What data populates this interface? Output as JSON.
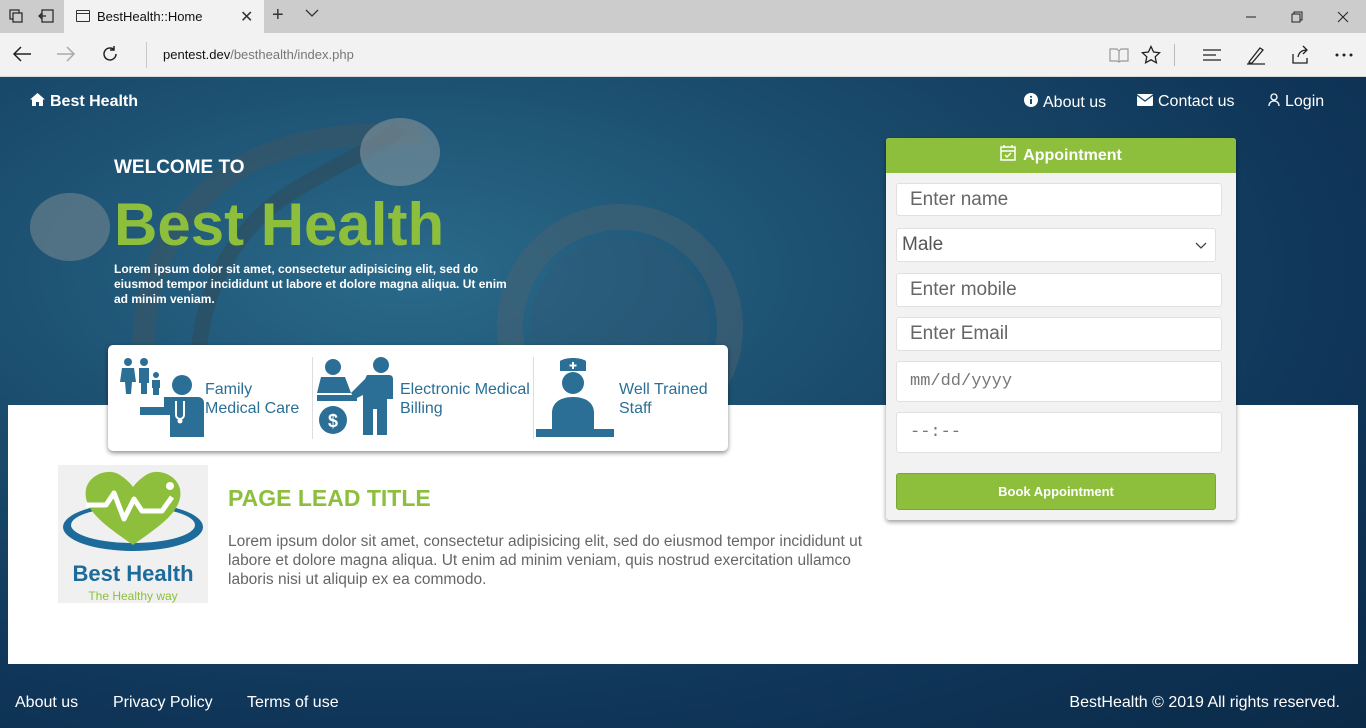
{
  "browser": {
    "tab_title": "BestHealth::Home",
    "url_host": "pentest.dev",
    "url_path": "/besthealth/index.php"
  },
  "nav": {
    "brand": "Best Health",
    "about": "About us",
    "contact": "Contact us",
    "login": "Login"
  },
  "hero": {
    "welcome": "WELCOME TO",
    "title": "Best Health",
    "text": "Lorem ipsum dolor sit amet, consectetur adipisicing elit, sed do eiusmod tempor incididunt ut labore et dolore magna aliqua. Ut enim ad minim veniam."
  },
  "features": [
    {
      "line1": "Family",
      "line2": "Medical Care"
    },
    {
      "line1": "Electronic Medical",
      "line2": "Billing"
    },
    {
      "line1": "Well Trained",
      "line2": "Staff"
    }
  ],
  "logo": {
    "name": "Best Health",
    "tagline": "The Healthy way"
  },
  "lead": {
    "title": "PAGE LEAD TITLE",
    "text": "Lorem ipsum dolor sit amet, consectetur adipisicing elit, sed do eiusmod tempor incididunt ut labore et dolore magna aliqua. Ut enim ad minim veniam, quis nostrud exercitation ullamco laboris nisi ut aliquip ex ea commodo."
  },
  "appointment": {
    "title": "Appointment",
    "name_placeholder": "Enter name",
    "gender_value": "Male",
    "mobile_placeholder": "Enter mobile",
    "email_placeholder": "Enter Email",
    "date_placeholder": "mm/dd/yyyy",
    "time_placeholder": "--:--",
    "button": "Book Appointment"
  },
  "footer": {
    "about": "About us",
    "privacy": "Privacy Policy",
    "terms": "Terms of use",
    "copyright": "BestHealth © 2019 All rights reserved."
  },
  "colors": {
    "accent_green": "#8dbf3d",
    "feature_blue": "#2b6f96",
    "hero_dark": "#0f3558"
  }
}
